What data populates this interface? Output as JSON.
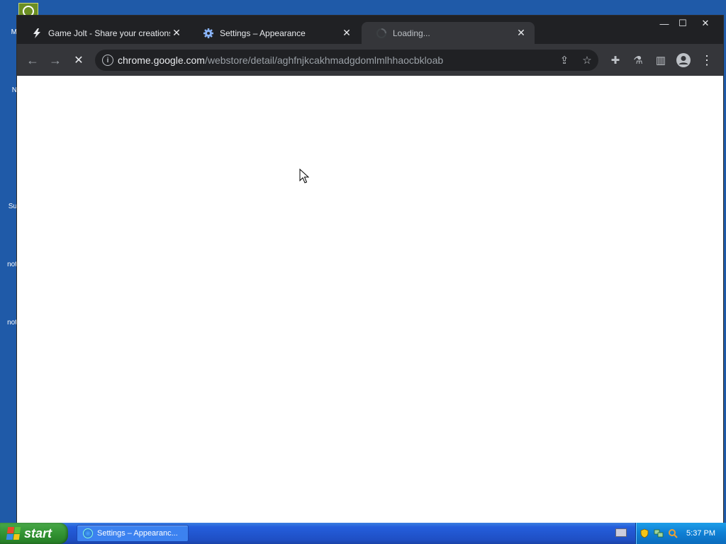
{
  "desktop": {
    "fragments": [
      "M",
      "N",
      "Su",
      "not",
      "not"
    ]
  },
  "browser": {
    "tabs": [
      {
        "title": "Game Jolt - Share your creations",
        "icon": "gamejolt-bolt-icon",
        "state": "inactive"
      },
      {
        "title": "Settings – Appearance",
        "icon": "gear-icon",
        "state": "inactive"
      },
      {
        "title": "Loading...",
        "icon": "loading-spinner-icon",
        "state": "active"
      }
    ],
    "close_glyph": "✕",
    "window_controls": {
      "minimize": "—",
      "maximize": "☐",
      "close": "✕"
    },
    "address_bar": {
      "host": "chrome.google.com",
      "path": "/webstore/detail/aghfnjkcakhmadgdomlmlhhaocbkloab"
    },
    "nav": {
      "back": "←",
      "forward": "→",
      "stop": "✕"
    },
    "toolbar_icons": {
      "share": "⇪",
      "bookmark": "☆",
      "extensions": "✚",
      "labs": "⚗",
      "side_panel": "▥",
      "profile": "●",
      "menu": "⋮"
    }
  },
  "taskbar": {
    "start_label": "start",
    "task_item_label": "Settings – Appearanc...",
    "clock": "5:37 PM"
  },
  "colors": {
    "chrome_dark": "#202124",
    "toolbar": "#35363a",
    "xp_blue": "#245edc",
    "start_green": "#2f8f2f"
  }
}
